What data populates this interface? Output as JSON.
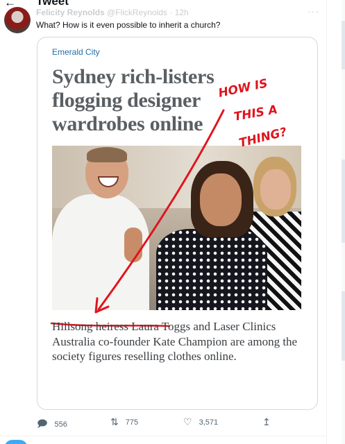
{
  "header": {
    "back_icon": "arrow-left-icon",
    "title": "Tweet"
  },
  "tweet": {
    "author_name": "Felicity Reynolds",
    "handle": "@FlickReynolds",
    "separator": "·",
    "time": "12h",
    "more_icon": "more-horizontal-icon",
    "text": "What? How is  it even possible to inherit a church?"
  },
  "media": {
    "section_label": "Emerald City",
    "headline_lines": [
      "Sydney rich-listers",
      "flogging designer",
      "wardrobes online"
    ],
    "annotation_lines": [
      "HOW IS",
      "THIS A",
      "THING?"
    ],
    "annotation_color": "#e0141e",
    "caption": {
      "highlight": "Hillsong heiress",
      "rest": " Laura Toggs and Laser Clinics Australia co-founder Kate Champion are among the society figures reselling clothes online."
    }
  },
  "actions": {
    "reply": {
      "icon": "reply-icon",
      "count": "556"
    },
    "retweet": {
      "icon": "retweet-icon",
      "count": "775"
    },
    "like": {
      "icon": "heart-icon",
      "count": "3,571"
    },
    "share": {
      "icon": "share-icon"
    }
  },
  "colors": {
    "accent": "#1d9bf0",
    "muted": "#536471",
    "border": "#cfd9de"
  }
}
